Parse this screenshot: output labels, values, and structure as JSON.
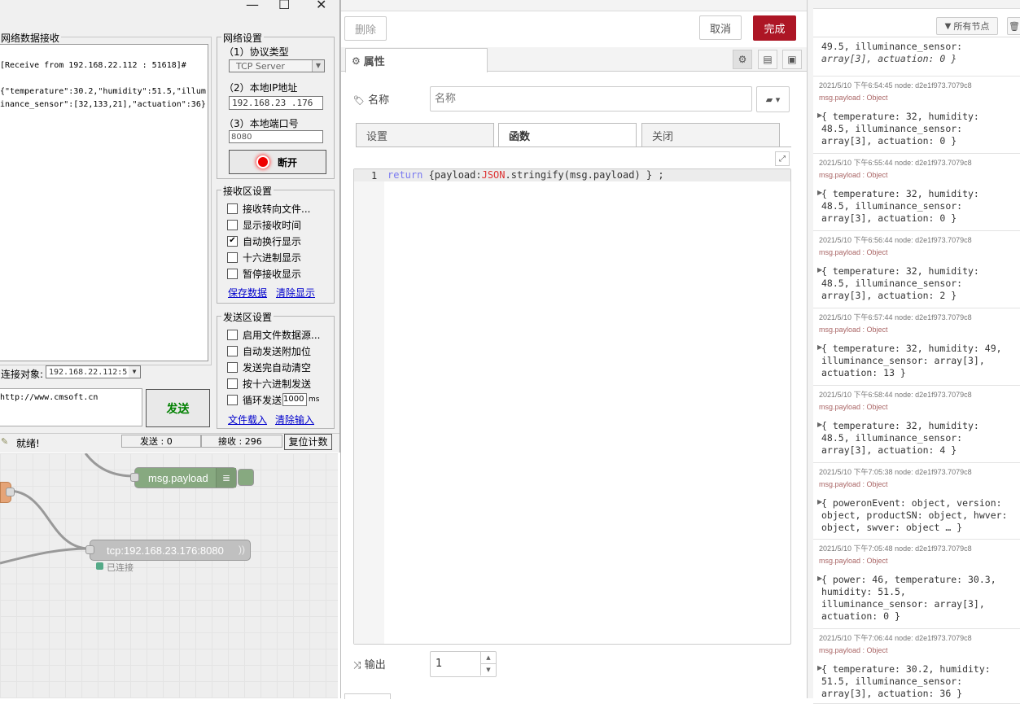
{
  "tool": {
    "recv_group_title": "网络数据接收",
    "recv_lines": [
      "[Receive from 192.168.22.112 : 51618]#",
      "",
      "{\"temperature\":30.2,\"humidity\":51.5,\"illum",
      "inance_sensor\":[32,133,21],\"actuation\":36}"
    ],
    "net_group_title": "网络设置",
    "proto_label": "（1）协议类型",
    "proto_value": "TCP Server",
    "ip_label": "（2）本地IP地址",
    "ip_value": "192.168.23 .176",
    "port_label": "（3）本地端口号",
    "port_value": "8080",
    "disconnect_label": "断开",
    "recv_settings_title": "接收区设置",
    "recv_options": [
      {
        "label": "接收转向文件...",
        "checked": false
      },
      {
        "label": "显示接收时间",
        "checked": false
      },
      {
        "label": "自动换行显示",
        "checked": true
      },
      {
        "label": "十六进制显示",
        "checked": false
      },
      {
        "label": "暂停接收显示",
        "checked": false
      }
    ],
    "save_data": "保存数据",
    "clear_display": "清除显示",
    "send_settings_title": "发送区设置",
    "send_options": [
      {
        "label": "启用文件数据源...",
        "checked": false
      },
      {
        "label": "自动发送附加位",
        "checked": false
      },
      {
        "label": "发送完自动清空",
        "checked": false
      },
      {
        "label": "按十六进制发送",
        "checked": false
      }
    ],
    "loop_send_label": "循环发送",
    "loop_interval": "1000",
    "loop_unit": "ms",
    "load_file": "文件载入",
    "clear_input": "清除输入",
    "target_label": "连接对象:",
    "target_value": "192.168.22.112:5",
    "send_text": "http://www.cmsoft.cn",
    "send_button": "发送",
    "status_ready": "就绪!",
    "sent_label": "发送 : 0",
    "recv_count_label": "接收 : 296",
    "reset_count": "复位计数"
  },
  "canvas": {
    "debug_node": "msg.payload",
    "tcp_node": "tcp:192.168.23.176:8080",
    "tcp_status": "已连接"
  },
  "editor": {
    "delete_button": "删除",
    "cancel_button": "取消",
    "done_button": "完成",
    "properties_tab": "属性",
    "name_label": "名称",
    "name_placeholder": "名称",
    "tabs": [
      "设置",
      "函数",
      "关闭"
    ],
    "code_line_number": "1",
    "outputs_label": "输出",
    "outputs_value": "1"
  },
  "debug": {
    "filter_button": "所有节点",
    "top_partial": [
      "49.5, illuminance_sensor:",
      "array[3], actuation: 0 }"
    ],
    "messages": [
      {
        "meta": "2021/5/10 下午6:54:45   node: d2e1f973.7079c8",
        "topic": "msg.payload : Object",
        "lines": [
          "{ temperature: 32, humidity:",
          "48.5, illuminance_sensor:",
          "array[3], actuation: 0 }"
        ]
      },
      {
        "meta": "2021/5/10 下午6:55:44   node: d2e1f973.7079c8",
        "topic": "msg.payload : Object",
        "lines": [
          "{ temperature: 32, humidity:",
          "48.5, illuminance_sensor:",
          "array[3], actuation: 0 }"
        ]
      },
      {
        "meta": "2021/5/10 下午6:56:44   node: d2e1f973.7079c8",
        "topic": "msg.payload : Object",
        "lines": [
          "{ temperature: 32, humidity:",
          "48.5, illuminance_sensor:",
          "array[3], actuation: 2 }"
        ]
      },
      {
        "meta": "2021/5/10 下午6:57:44   node: d2e1f973.7079c8",
        "topic": "msg.payload : Object",
        "lines": [
          "{ temperature: 32, humidity: 49,",
          "illuminance_sensor: array[3],",
          "actuation: 13 }"
        ]
      },
      {
        "meta": "2021/5/10 下午6:58:44   node: d2e1f973.7079c8",
        "topic": "msg.payload : Object",
        "lines": [
          "{ temperature: 32, humidity:",
          "48.5, illuminance_sensor:",
          "array[3], actuation: 4 }"
        ]
      },
      {
        "meta": "2021/5/10 下午7:05:38   node: d2e1f973.7079c8",
        "topic": "msg.payload : Object",
        "lines": [
          "{ poweronEvent: object, version:",
          "object, productSN: object, hwver:",
          "object, swver: object … }"
        ]
      },
      {
        "meta": "2021/5/10 下午7:05:48   node: d2e1f973.7079c8",
        "topic": "msg.payload : Object",
        "lines": [
          "{ power: 46, temperature: 30.3,",
          "humidity: 51.5,",
          "illuminance_sensor: array[3],",
          "actuation: 0 }"
        ]
      },
      {
        "meta": "2021/5/10 下午7:06:44   node: d2e1f973.7079c8",
        "topic": "msg.payload : Object",
        "lines": [
          "{ temperature: 30.2, humidity:",
          "51.5, illuminance_sensor:",
          "array[3], actuation: 36 }"
        ]
      }
    ]
  },
  "colors": {
    "done_red": "#ad1625",
    "debug_node_green": "#87a980",
    "tcp_node_gray": "#c0c0c0"
  }
}
